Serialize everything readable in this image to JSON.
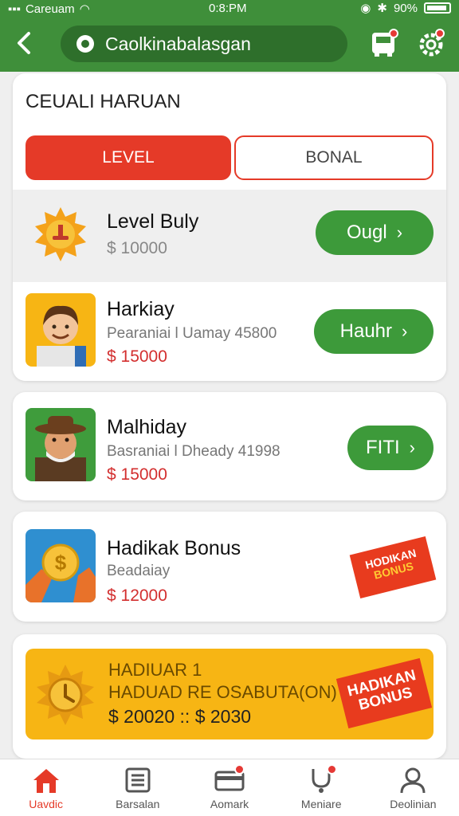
{
  "status_bar": {
    "carrier": "Careuam",
    "time": "0:8:PM",
    "battery": "90%"
  },
  "app_bar": {
    "search_text": "Caolkinabalasgan"
  },
  "panel": {
    "title": "CEUALI HARUAN",
    "tabs": [
      {
        "label": "LEVEL",
        "active": true
      },
      {
        "label": "BONAL",
        "active": false
      }
    ]
  },
  "items": [
    {
      "name": "Level Buly",
      "price": "$ 10000",
      "button": "Ougl"
    },
    {
      "name": "Harkiay",
      "subtitle": "Pearaniai l Uamay 45800",
      "price": "$ 15000",
      "button": "Hauhr"
    },
    {
      "name": "Malhiday",
      "subtitle": "Basraniai l Dheady 41998",
      "price": "$ 15000",
      "button": "FITI"
    },
    {
      "name": "Hadikak Bonus",
      "subtitle": "Beadaiay",
      "price": "$ 12000",
      "badge": [
        "HODIKAN",
        "BONUS"
      ]
    }
  ],
  "promo": {
    "title": "HADIUAR 1",
    "subtitle": "HADUAD RE OSABUTA(ON)",
    "price": "$ 20020 :: $ 2030",
    "badge": [
      "HADIKAN",
      "BONUS"
    ]
  },
  "bottom_nav": [
    {
      "label": "Uavdic",
      "icon": "home-icon",
      "active": true
    },
    {
      "label": "Barsalan",
      "icon": "list-icon",
      "active": false
    },
    {
      "label": "Aomark",
      "icon": "card-icon",
      "active": false,
      "dot": true
    },
    {
      "label": "Meniare",
      "icon": "stethoscope-icon",
      "active": false,
      "dot": true
    },
    {
      "label": "Deolinian",
      "icon": "profile-icon",
      "active": false
    }
  ],
  "colors": {
    "header_green": "#3f8f3a",
    "accent_red": "#e53a28",
    "button_green": "#3d9a3a",
    "promo_yellow": "#f7b514"
  }
}
